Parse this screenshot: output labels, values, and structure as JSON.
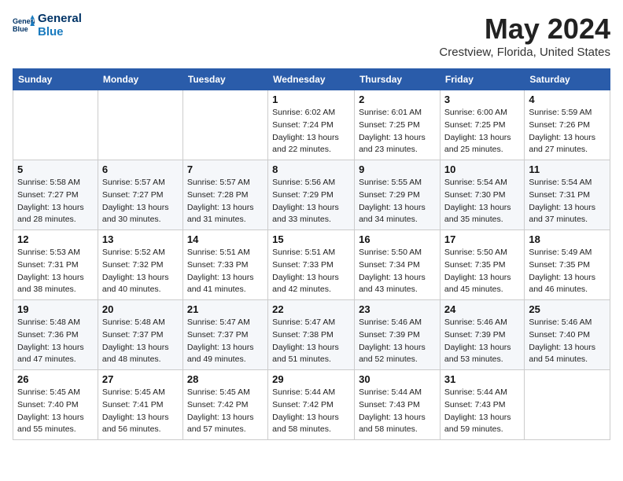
{
  "logo": {
    "line1": "General",
    "line2": "Blue"
  },
  "title": "May 2024",
  "location": "Crestview, Florida, United States",
  "weekdays": [
    "Sunday",
    "Monday",
    "Tuesday",
    "Wednesday",
    "Thursday",
    "Friday",
    "Saturday"
  ],
  "weeks": [
    [
      {
        "day": "",
        "info": ""
      },
      {
        "day": "",
        "info": ""
      },
      {
        "day": "",
        "info": ""
      },
      {
        "day": "1",
        "info": "Sunrise: 6:02 AM\nSunset: 7:24 PM\nDaylight: 13 hours\nand 22 minutes."
      },
      {
        "day": "2",
        "info": "Sunrise: 6:01 AM\nSunset: 7:25 PM\nDaylight: 13 hours\nand 23 minutes."
      },
      {
        "day": "3",
        "info": "Sunrise: 6:00 AM\nSunset: 7:25 PM\nDaylight: 13 hours\nand 25 minutes."
      },
      {
        "day": "4",
        "info": "Sunrise: 5:59 AM\nSunset: 7:26 PM\nDaylight: 13 hours\nand 27 minutes."
      }
    ],
    [
      {
        "day": "5",
        "info": "Sunrise: 5:58 AM\nSunset: 7:27 PM\nDaylight: 13 hours\nand 28 minutes."
      },
      {
        "day": "6",
        "info": "Sunrise: 5:57 AM\nSunset: 7:27 PM\nDaylight: 13 hours\nand 30 minutes."
      },
      {
        "day": "7",
        "info": "Sunrise: 5:57 AM\nSunset: 7:28 PM\nDaylight: 13 hours\nand 31 minutes."
      },
      {
        "day": "8",
        "info": "Sunrise: 5:56 AM\nSunset: 7:29 PM\nDaylight: 13 hours\nand 33 minutes."
      },
      {
        "day": "9",
        "info": "Sunrise: 5:55 AM\nSunset: 7:29 PM\nDaylight: 13 hours\nand 34 minutes."
      },
      {
        "day": "10",
        "info": "Sunrise: 5:54 AM\nSunset: 7:30 PM\nDaylight: 13 hours\nand 35 minutes."
      },
      {
        "day": "11",
        "info": "Sunrise: 5:54 AM\nSunset: 7:31 PM\nDaylight: 13 hours\nand 37 minutes."
      }
    ],
    [
      {
        "day": "12",
        "info": "Sunrise: 5:53 AM\nSunset: 7:31 PM\nDaylight: 13 hours\nand 38 minutes."
      },
      {
        "day": "13",
        "info": "Sunrise: 5:52 AM\nSunset: 7:32 PM\nDaylight: 13 hours\nand 40 minutes."
      },
      {
        "day": "14",
        "info": "Sunrise: 5:51 AM\nSunset: 7:33 PM\nDaylight: 13 hours\nand 41 minutes."
      },
      {
        "day": "15",
        "info": "Sunrise: 5:51 AM\nSunset: 7:33 PM\nDaylight: 13 hours\nand 42 minutes."
      },
      {
        "day": "16",
        "info": "Sunrise: 5:50 AM\nSunset: 7:34 PM\nDaylight: 13 hours\nand 43 minutes."
      },
      {
        "day": "17",
        "info": "Sunrise: 5:50 AM\nSunset: 7:35 PM\nDaylight: 13 hours\nand 45 minutes."
      },
      {
        "day": "18",
        "info": "Sunrise: 5:49 AM\nSunset: 7:35 PM\nDaylight: 13 hours\nand 46 minutes."
      }
    ],
    [
      {
        "day": "19",
        "info": "Sunrise: 5:48 AM\nSunset: 7:36 PM\nDaylight: 13 hours\nand 47 minutes."
      },
      {
        "day": "20",
        "info": "Sunrise: 5:48 AM\nSunset: 7:37 PM\nDaylight: 13 hours\nand 48 minutes."
      },
      {
        "day": "21",
        "info": "Sunrise: 5:47 AM\nSunset: 7:37 PM\nDaylight: 13 hours\nand 49 minutes."
      },
      {
        "day": "22",
        "info": "Sunrise: 5:47 AM\nSunset: 7:38 PM\nDaylight: 13 hours\nand 51 minutes."
      },
      {
        "day": "23",
        "info": "Sunrise: 5:46 AM\nSunset: 7:39 PM\nDaylight: 13 hours\nand 52 minutes."
      },
      {
        "day": "24",
        "info": "Sunrise: 5:46 AM\nSunset: 7:39 PM\nDaylight: 13 hours\nand 53 minutes."
      },
      {
        "day": "25",
        "info": "Sunrise: 5:46 AM\nSunset: 7:40 PM\nDaylight: 13 hours\nand 54 minutes."
      }
    ],
    [
      {
        "day": "26",
        "info": "Sunrise: 5:45 AM\nSunset: 7:40 PM\nDaylight: 13 hours\nand 55 minutes."
      },
      {
        "day": "27",
        "info": "Sunrise: 5:45 AM\nSunset: 7:41 PM\nDaylight: 13 hours\nand 56 minutes."
      },
      {
        "day": "28",
        "info": "Sunrise: 5:45 AM\nSunset: 7:42 PM\nDaylight: 13 hours\nand 57 minutes."
      },
      {
        "day": "29",
        "info": "Sunrise: 5:44 AM\nSunset: 7:42 PM\nDaylight: 13 hours\nand 58 minutes."
      },
      {
        "day": "30",
        "info": "Sunrise: 5:44 AM\nSunset: 7:43 PM\nDaylight: 13 hours\nand 58 minutes."
      },
      {
        "day": "31",
        "info": "Sunrise: 5:44 AM\nSunset: 7:43 PM\nDaylight: 13 hours\nand 59 minutes."
      },
      {
        "day": "",
        "info": ""
      }
    ]
  ]
}
